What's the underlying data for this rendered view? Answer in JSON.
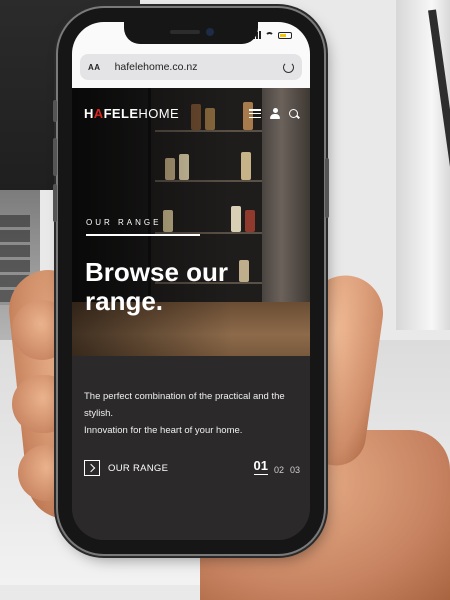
{
  "browser": {
    "text_size_label": "AA",
    "url": "hafelehome.co.nz"
  },
  "site": {
    "logo_brand": "HAFELE",
    "logo_home": "HOME",
    "colors": {
      "accent": "#d6261f",
      "panel": "#2b2929",
      "text": "#ffffff"
    }
  },
  "hero": {
    "eyebrow": "OUR RANGE",
    "title": "Browse our range."
  },
  "info": {
    "description_line1": "The perfect combination of the practical and the stylish.",
    "description_line2": "Innovation for the heart of your home.",
    "cta_label": "OUR RANGE",
    "pager": [
      "01",
      "02",
      "03"
    ],
    "active_page": "01"
  },
  "icons": [
    "menu-icon",
    "user-icon",
    "search-icon",
    "reload-icon",
    "chevron-right-icon",
    "signal-icon",
    "wifi-icon",
    "battery-icon"
  ]
}
